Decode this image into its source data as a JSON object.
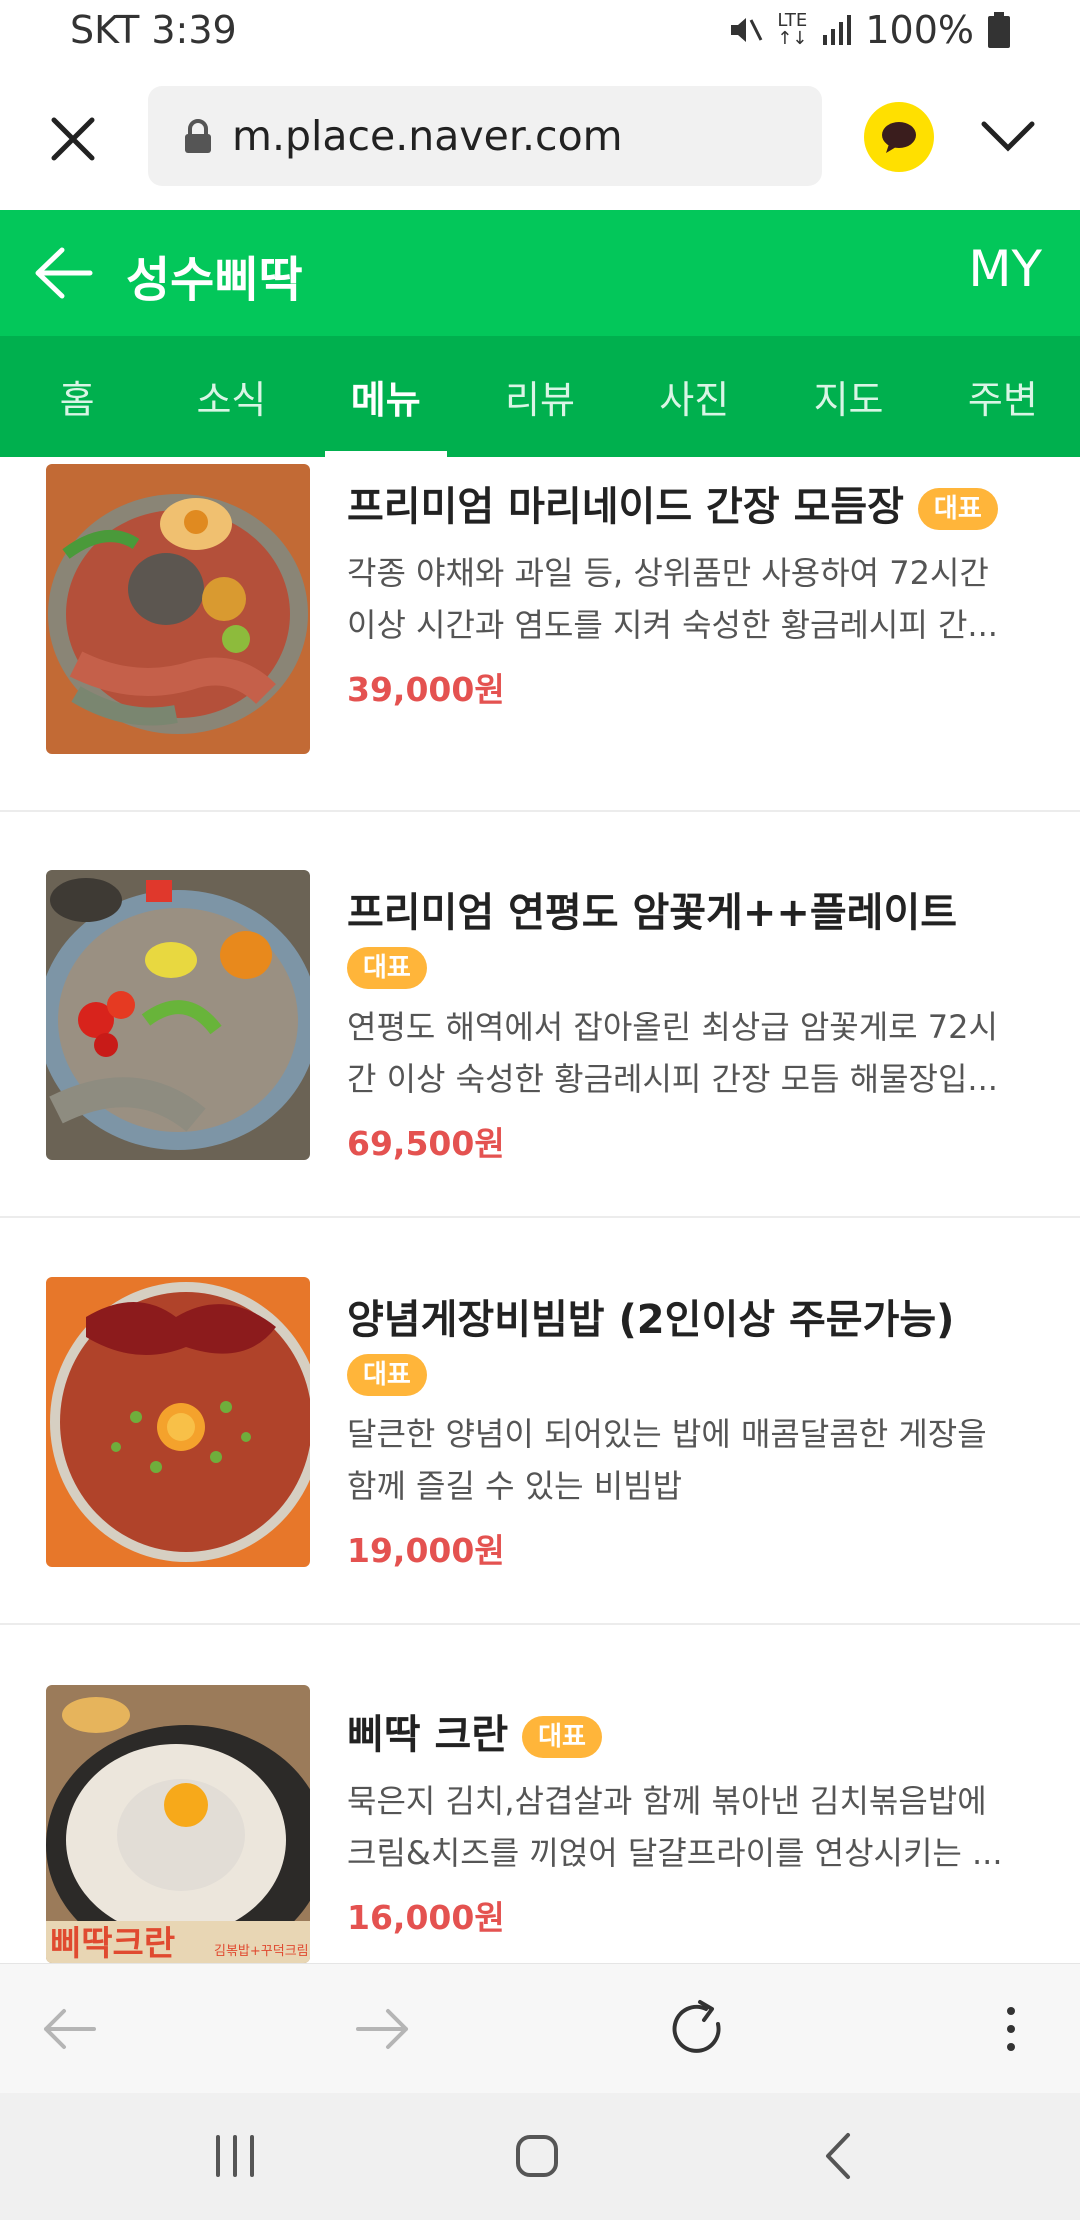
{
  "status_bar": {
    "carrier_time": "SKT 3:39",
    "network": "LTE",
    "battery": "100%"
  },
  "browser": {
    "url": "m.place.naver.com"
  },
  "place": {
    "title": "성수삐딱",
    "my_label": "MY",
    "tabs": [
      {
        "label": "홈"
      },
      {
        "label": "소식"
      },
      {
        "label": "메뉴"
      },
      {
        "label": "리뷰"
      },
      {
        "label": "사진"
      },
      {
        "label": "지도"
      },
      {
        "label": "주변"
      }
    ],
    "active_tab": "메뉴"
  },
  "menu": [
    {
      "name": "프리미엄 마리네이드 간장 모듬장",
      "badge": "대표",
      "desc_line1": "각종 야채와 과일 등, 상위품만 사용하여 72시간",
      "desc_line2": "이상 시간과 염도를 지켜 숙성한 황금레시피 간...",
      "price": "39,000원"
    },
    {
      "name": "프리미엄 연평도 암꽃게++플레이트",
      "badge": "대표",
      "desc_line1": "연평도 해역에서 잡아올린 최상급 암꽃게로 72시",
      "desc_line2": "간 이상 숙성한 황금레시피 간장 모듬 해물장입...",
      "price": "69,500원"
    },
    {
      "name": "양념게장비빔밥 (2인이상 주문가능)",
      "badge": "대표",
      "desc_line1": "달큰한 양념이 되어있는 밥에 매콤달콤한 게장을",
      "desc_line2": "함께 즐길 수 있는 비빔밥",
      "price": "19,000원"
    },
    {
      "name": "삐딱 크란",
      "badge": "대표",
      "desc_line1": "묵은지 김치,삼겹살과 함께 볶아낸 김치볶음밥에",
      "desc_line2": "크림&치즈를 끼얹어 달걀프라이를 연상시키는 ...",
      "price": "16,000원",
      "image_caption": "삐딱크란",
      "image_subcaption": "김볶밥+꾸덕크림"
    }
  ],
  "colors": {
    "naver_green": "#03c75a",
    "tab_green": "#00b04e",
    "price_red": "#e45250",
    "badge_orange": "#ffb53a"
  },
  "icons": [
    "close-icon",
    "lock-icon",
    "kakaotalk-icon",
    "chevron-down-icon",
    "back-arrow-icon",
    "forward-arrow-icon",
    "refresh-icon",
    "more-icon",
    "recents-icon",
    "home-icon",
    "nav-back-icon"
  ]
}
